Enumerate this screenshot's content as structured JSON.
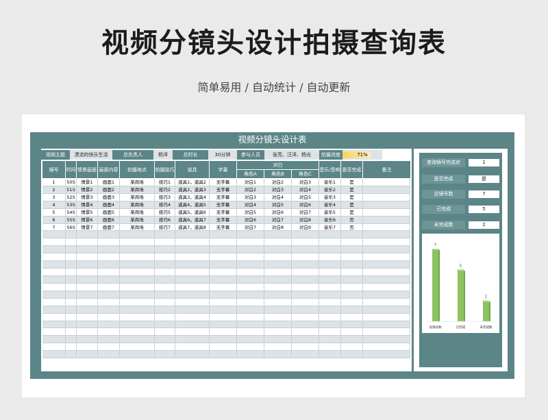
{
  "header": {
    "title": "视频分镜头设计拍摄查询表",
    "subtitle": "简单易用  /  自动统计  /  自动更新"
  },
  "sheet": {
    "title": "视频分镜头设计表"
  },
  "info": {
    "theme_label": "视频主题",
    "theme_value": "漂流的快乐生活",
    "owner_label": "总负责人",
    "owner_value": "杨洋",
    "duration_label": "总时长",
    "duration_value": "30分钟",
    "members_label": "参与人员",
    "members_value": "张亮、汪洋、杨光",
    "progress_label": "拍摄进度",
    "progress_value": "71%",
    "progress_fraction": 0.71
  },
  "columns": {
    "shot_no": "镜号",
    "time": "时间",
    "scene": "情景画面",
    "frame": "画面内容",
    "location": "拍摄地点",
    "technique": "拍摄技巧",
    "props": "道具",
    "subtitle": "字幕",
    "dialogue": "对白",
    "role_a": "角色A",
    "role_b": "角色B",
    "role_c": "角色C",
    "music": "音乐/音响",
    "done": "是否完成",
    "remark": "备注"
  },
  "rows": [
    [
      "1",
      "50S",
      "情景1",
      "画面1",
      "某商场",
      "技巧1",
      "道具1，道具2",
      "无字幕",
      "对白1",
      "对白2",
      "对白3",
      "音乐1",
      "是",
      ""
    ],
    [
      "2",
      "51S",
      "情景2",
      "画面2",
      "某商场",
      "技巧2",
      "道具2，道具3",
      "无字幕",
      "对白2",
      "对白3",
      "对白4",
      "音乐2",
      "是",
      ""
    ],
    [
      "3",
      "52S",
      "情景3",
      "画面3",
      "某商场",
      "技巧3",
      "道具3，道具4",
      "无字幕",
      "对白3",
      "对白4",
      "对白5",
      "音乐3",
      "是",
      ""
    ],
    [
      "4",
      "53S",
      "情景4",
      "画面4",
      "某商场",
      "技巧4",
      "道具4，道具5",
      "无字幕",
      "对白4",
      "对白5",
      "对白6",
      "音乐4",
      "是",
      ""
    ],
    [
      "5",
      "54S",
      "情景5",
      "画面5",
      "某商场",
      "技巧5",
      "道具5，道具6",
      "无字幕",
      "对白5",
      "对白6",
      "对白7",
      "音乐5",
      "是",
      ""
    ],
    [
      "6",
      "55S",
      "情景6",
      "画面6",
      "某商场",
      "技巧6",
      "道具6，道具7",
      "无字幕",
      "对白6",
      "对白7",
      "对白8",
      "音乐6",
      "否",
      ""
    ],
    [
      "7",
      "56S",
      "情景7",
      "画面7",
      "某商场",
      "技巧7",
      "道具7，道具8",
      "无字幕",
      "对白7",
      "对白8",
      "对白9",
      "音乐7",
      "否",
      ""
    ]
  ],
  "empty_rows": 17,
  "query": {
    "status_label": "查询镜号完成状",
    "status_value": "1",
    "done_label": "是否完成",
    "done_value": "是",
    "total_label": "总镜号数",
    "total_value": "7",
    "completed_label": "已完成",
    "completed_value": "5",
    "incomplete_label": "未完成数",
    "incomplete_value": "2"
  },
  "chart_data": {
    "type": "bar",
    "categories": [
      "总镜号数",
      "已完成",
      "未完成数"
    ],
    "values": [
      7,
      5,
      2
    ],
    "ylim": [
      0,
      7
    ],
    "color": "#8dc35f"
  },
  "colors": {
    "teal": "#5b8586",
    "row_alt": "#dde3e6",
    "bar": "#8dc35f",
    "progress": "#f6d35a"
  }
}
